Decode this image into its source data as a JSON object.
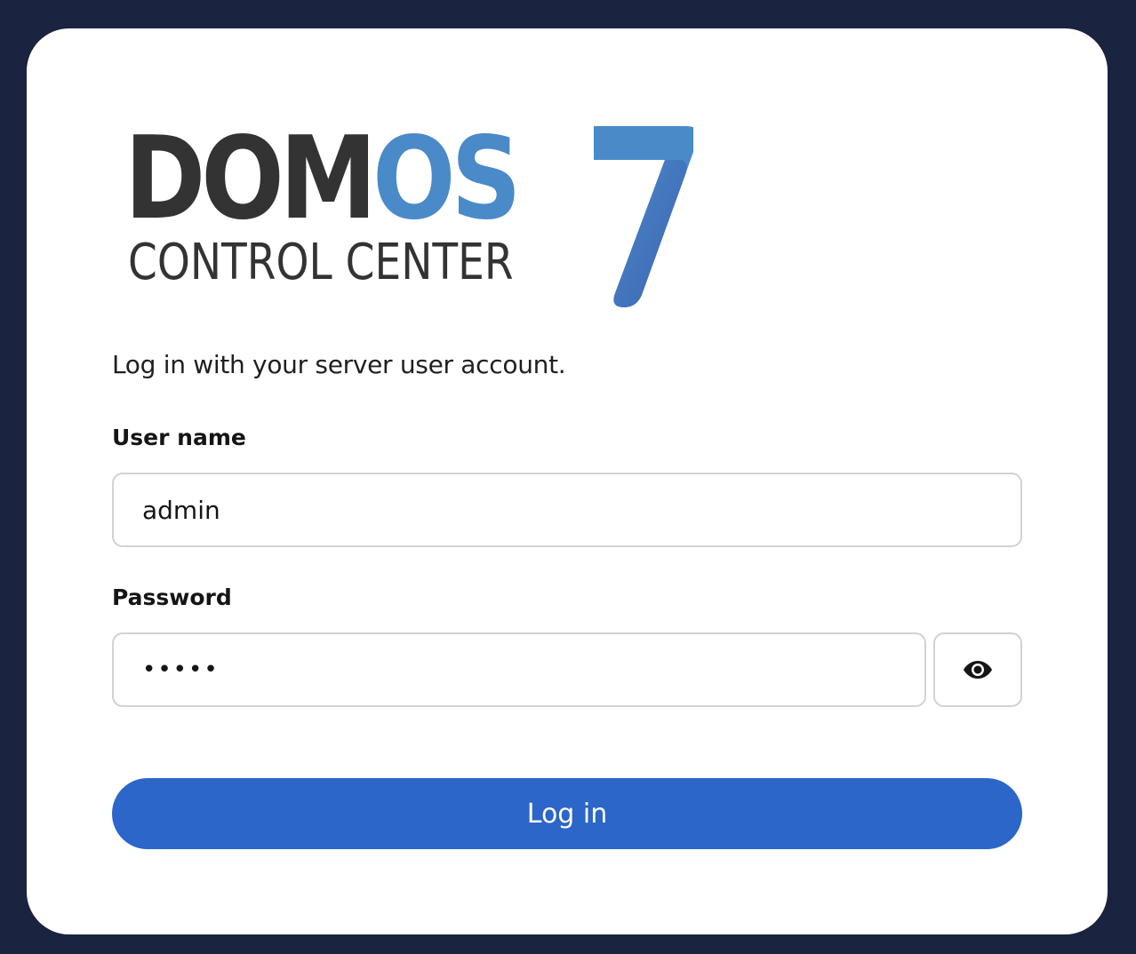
{
  "logo": {
    "word_dark": "DOM",
    "word_blue": "OS",
    "version": "7",
    "subtitle": "CONTROL CENTER"
  },
  "colors": {
    "background": "#1a2340",
    "card": "#ffffff",
    "logo_dark": "#333333",
    "logo_blue": "#4a8ac9",
    "primary_button": "#2b66c8"
  },
  "form": {
    "intro": "Log in with your server user account.",
    "username_label": "User name",
    "username_value": "admin",
    "password_label": "Password",
    "password_value": "•••••",
    "show_password_icon": "eye-icon",
    "submit_label": "Log in"
  }
}
